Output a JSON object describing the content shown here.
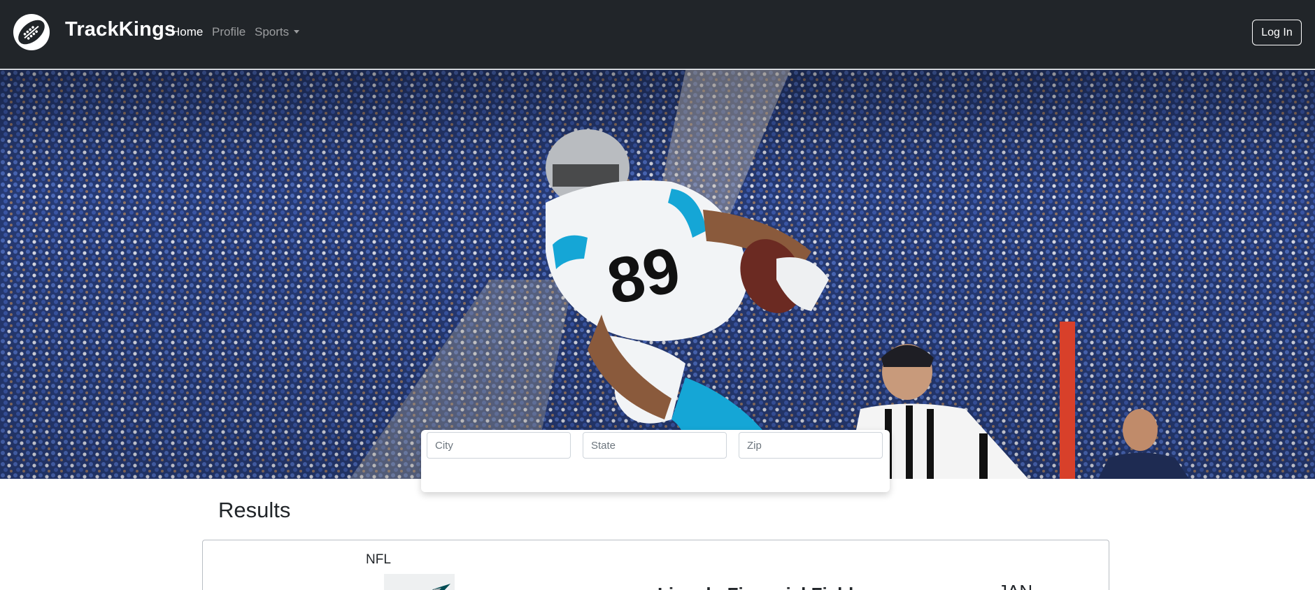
{
  "brand": {
    "name": "TrackKings",
    "logo_icon": "football-icon"
  },
  "nav": {
    "home": "Home",
    "profile": "Profile",
    "sports": "Sports",
    "active": "Home",
    "login": "Log In"
  },
  "hero": {
    "image": "football-player-catching-ball-in-stadium"
  },
  "search": {
    "city_placeholder": "City",
    "state_placeholder": "State",
    "zip_placeholder": "Zip"
  },
  "results": {
    "title": "Results",
    "items": [
      {
        "league": "NFL",
        "venue": "Lincoln Financial Field",
        "month": "JAN",
        "logo_icon": "eagles-logo-icon"
      }
    ]
  },
  "colors": {
    "navbar": "#212529",
    "accent_white": "#ffffff",
    "muted_nav": "#8c9095"
  }
}
